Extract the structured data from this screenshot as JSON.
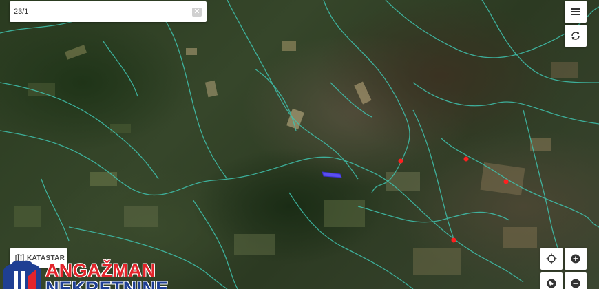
{
  "search": {
    "value": "23/1",
    "clear_glyph": "✕"
  },
  "toolbar": {
    "menu_icon": "hamburger-menu-icon",
    "refresh_icon": "rotate-icon"
  },
  "katastar": {
    "label": "KATASTAR",
    "icon": "map-icon"
  },
  "zoom": {
    "locate_icon": "crosshair-icon",
    "zoom_in_icon": "plus-icon",
    "layers_icon": "globe-icon",
    "zoom_out_icon": "minus-icon"
  },
  "logo": {
    "line1": "ANGAŽMAN",
    "line2": "NEKRETNINE",
    "color_red": "#e3242b",
    "color_blue": "#1f3f93"
  },
  "colors": {
    "road": "#40c4b0",
    "marker": "#ff1f1f",
    "parcel": "#5b4ff0"
  }
}
